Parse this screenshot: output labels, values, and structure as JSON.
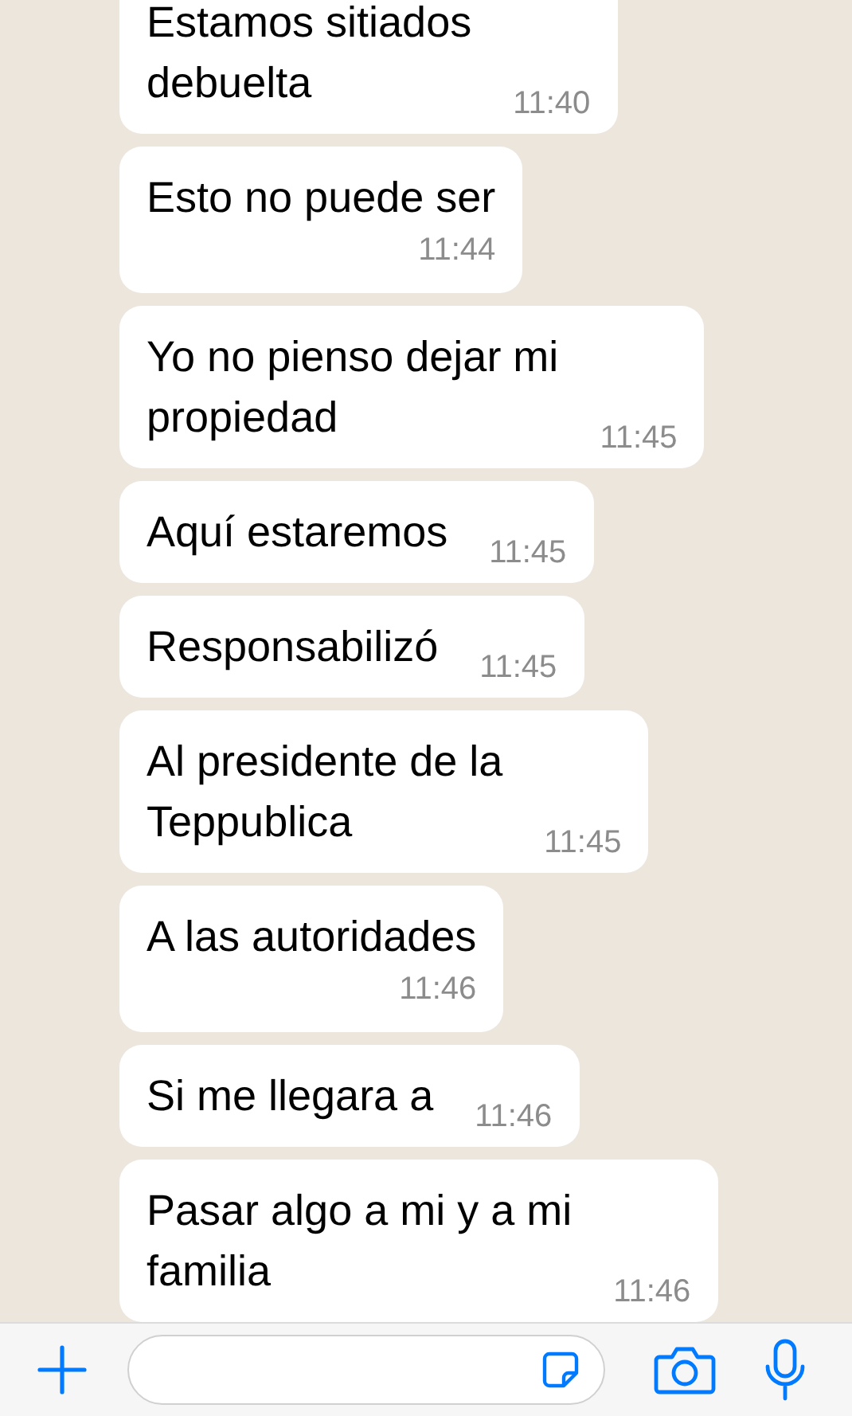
{
  "messages": [
    {
      "text": "Estamos sitiados\ndebuelta",
      "time": "11:40",
      "kind": "inline"
    },
    {
      "text": "Esto no puede ser",
      "time": "11:44",
      "kind": "stacked"
    },
    {
      "text": "Yo no pienso dejar mi\npropiedad",
      "time": "11:45",
      "kind": "inline"
    },
    {
      "text": "Aquí estaremos",
      "time": "11:45",
      "kind": "inline"
    },
    {
      "text": "Responsabilizó",
      "time": "11:45",
      "kind": "inline"
    },
    {
      "text": "Al presidente de la\nTeppublica",
      "time": "11:45",
      "kind": "inline"
    },
    {
      "text": "A las autoridades",
      "time": "11:46",
      "kind": "stacked"
    },
    {
      "text": "Si me llegara a",
      "time": "11:46",
      "kind": "inline"
    },
    {
      "text": "Pasar algo a mi y a mi\nfamilia",
      "time": "11:46",
      "kind": "inline"
    }
  ]
}
